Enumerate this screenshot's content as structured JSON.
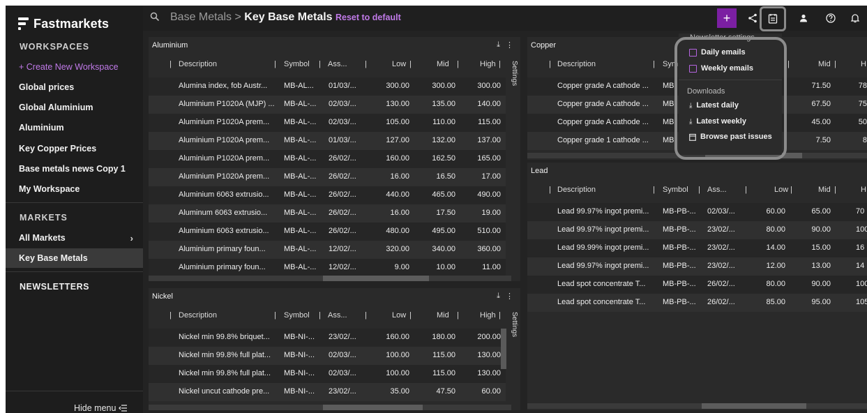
{
  "app": {
    "logo_text": "Fastmarkets"
  },
  "sidebar": {
    "workspaces_heading": "WORKSPACES",
    "create_label": "+ Create New Workspace",
    "workspaces": [
      "Global prices",
      "Global Aluminium",
      "Aluminium",
      "Key Copper Prices",
      "Base metals news Copy 1",
      "My Workspace"
    ],
    "markets_heading": "MARKETS",
    "markets": [
      "All Markets",
      "Key Base Metals"
    ],
    "newsletters_heading": "NEWSLETTERS",
    "hide_menu": "Hide menu"
  },
  "topbar": {
    "breadcrumb_parent": "Base Metals",
    "breadcrumb_sep": " > ",
    "breadcrumb_current": "Key Base Metals",
    "reset_label": "Reset to default"
  },
  "icons": {
    "search": "search-icon",
    "plus": "plus-icon",
    "share": "share-icon",
    "newsletter": "newsletter-icon",
    "user": "user-icon",
    "help": "help-icon",
    "bell": "bell-icon",
    "download": "download-icon",
    "more": "more-vertical-icon"
  },
  "colors": {
    "accent": "#c07ae8",
    "plus_button": "#7b1fa2"
  },
  "columns": {
    "description": "Description",
    "symbol": "Symbol",
    "assessed": "Ass...",
    "low": "Low",
    "mid": "Mid",
    "high": "High"
  },
  "settings_label": "Settings",
  "copper_symbol_header": "Sym",
  "copper_high_header": "H",
  "panels": {
    "aluminium": {
      "title": "Aluminium",
      "rows": [
        [
          "Alumina index, fob Austr...",
          "MB-AL...",
          "01/03/...",
          "300.00",
          "300.00",
          "300.00"
        ],
        [
          "Aluminium P1020A (MJP) ...",
          "MB-AL-...",
          "02/03/...",
          "130.00",
          "135.00",
          "140.00"
        ],
        [
          "Aluminium P1020A prem...",
          "MB-AL-...",
          "02/03/...",
          "105.00",
          "110.00",
          "115.00"
        ],
        [
          "Aluminium P1020A prem...",
          "MB-AL-...",
          "01/03/...",
          "127.00",
          "132.00",
          "137.00"
        ],
        [
          "Aluminium P1020A prem...",
          "MB-AL-...",
          "26/02/...",
          "160.00",
          "162.50",
          "165.00"
        ],
        [
          "Aluminium P1020A prem...",
          "MB-AL-...",
          "26/02/...",
          "16.00",
          "16.50",
          "17.00"
        ],
        [
          "Aluminium 6063 extrusio...",
          "MB-AL-...",
          "26/02/...",
          "440.00",
          "465.00",
          "490.00"
        ],
        [
          "Aluminum 6063 extrusio...",
          "MB-AL-...",
          "26/02/...",
          "16.00",
          "17.50",
          "19.00"
        ],
        [
          "Aluminium 6063 extrusio...",
          "MB-AL-...",
          "26/02/...",
          "480.00",
          "495.00",
          "510.00"
        ],
        [
          "Aluminium primary foun...",
          "MB-AL-...",
          "12/02/...",
          "320.00",
          "340.00",
          "360.00"
        ],
        [
          "Aluminium primary foun...",
          "MB-AL-...",
          "12/02/...",
          "9.00",
          "10.00",
          "11.00"
        ]
      ]
    },
    "nickel": {
      "title": "Nickel",
      "rows": [
        [
          "Nickel min 99.8% briquet...",
          "MB-NI-...",
          "23/02/...",
          "160.00",
          "180.00",
          "200.00"
        ],
        [
          "Nickel min 99.8% full plat...",
          "MB-NI-...",
          "02/03/...",
          "100.00",
          "115.00",
          "130.00"
        ],
        [
          "Nickel min 99.8% full plat...",
          "MB-NI-...",
          "02/03/...",
          "100.00",
          "115.00",
          "130.00"
        ],
        [
          "Nickel uncut cathode pre...",
          "MB-NI-...",
          "23/02/...",
          "35.00",
          "47.50",
          "60.00"
        ]
      ]
    },
    "copper": {
      "title": "Copper",
      "rows": [
        [
          "Copper grade A cathode ...",
          "MB",
          "71.50",
          "78"
        ],
        [
          "Copper grade A cathode ...",
          "MB",
          "67.50",
          "75"
        ],
        [
          "Copper grade A cathode ...",
          "MB",
          "45.00",
          "50"
        ],
        [
          "Copper grade 1 cathode ...",
          "MB",
          "7.50",
          "8"
        ]
      ]
    },
    "lead": {
      "title": "Lead",
      "rows": [
        [
          "Lead 99.97% ingot premi...",
          "MB-PB-...",
          "02/03/...",
          "60.00",
          "65.00",
          "70"
        ],
        [
          "Lead 99.97% ingot premi...",
          "MB-PB-...",
          "23/02/...",
          "80.00",
          "90.00",
          "100"
        ],
        [
          "Lead 99.99% ingot premi...",
          "MB-PB-...",
          "23/02/...",
          "14.00",
          "15.00",
          "16"
        ],
        [
          "Lead 99.97% ingot premi...",
          "MB-PB-...",
          "23/02/...",
          "12.00",
          "13.00",
          "14"
        ],
        [
          "Lead spot concentrate T...",
          "MB-PB-...",
          "26/02/...",
          "80.00",
          "90.00",
          "100"
        ],
        [
          "Lead spot concentrate T...",
          "MB-PB-...",
          "26/02/...",
          "85.00",
          "95.00",
          "105"
        ]
      ]
    }
  },
  "dropdown": {
    "settings_heading": "Newsletter settings",
    "daily_emails": "Daily emails",
    "weekly_emails": "Weekly emails",
    "downloads_heading": "Downloads",
    "latest_daily": "Latest daily",
    "latest_weekly": "Latest weekly",
    "browse_past": "Browse past issues"
  }
}
